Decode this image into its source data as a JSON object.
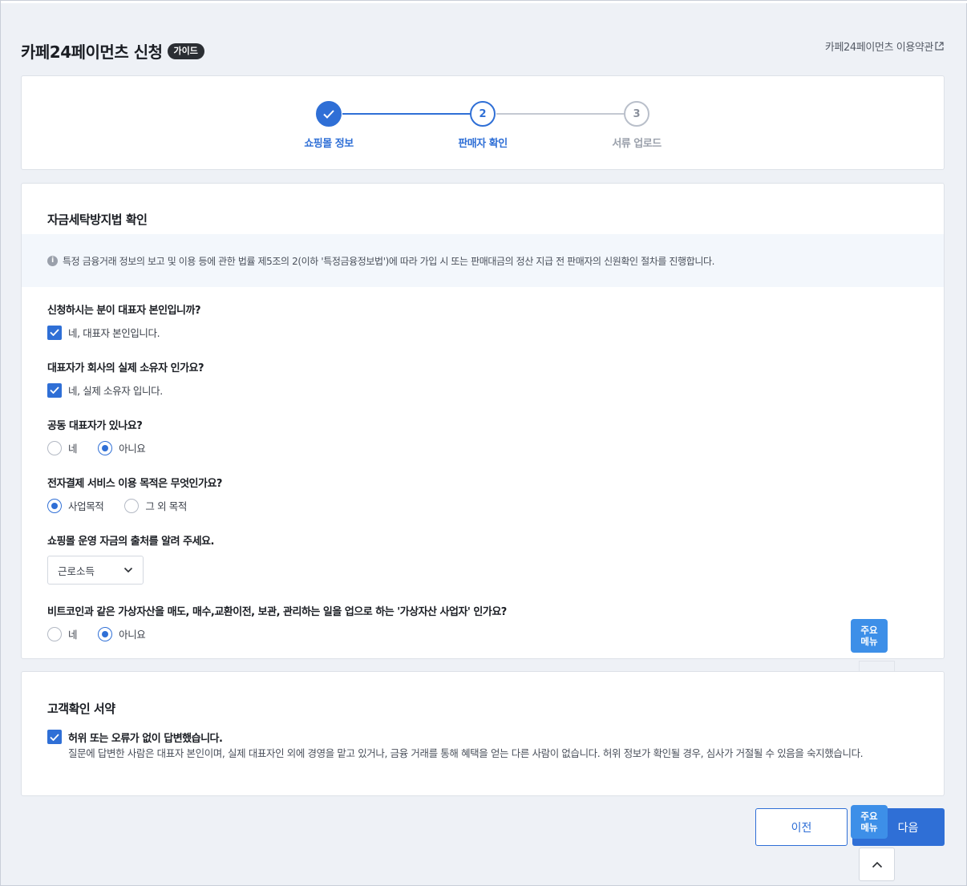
{
  "header": {
    "title": "카페24페이먼츠 신청",
    "guide_badge": "가이드",
    "terms_link": "카페24페이먼츠 이용약관"
  },
  "steps": [
    {
      "label": "쇼핑몰 정보",
      "number": "",
      "state": "done"
    },
    {
      "label": "판매자 확인",
      "number": "2",
      "state": "active"
    },
    {
      "label": "서류 업로드",
      "number": "3",
      "state": "todo"
    }
  ],
  "aml": {
    "title": "자금세탁방지법 확인",
    "notice": "특정 금융거래 정보의 보고 및 이용 등에 관한 법률 제5조의 2(이하 '특정금융정보법')에 따라 가입 시 또는 판매대금의 정산 지급 전 판매자의 신원확인 절차를 진행합니다.",
    "q1": {
      "label": "신청하시는 분이 대표자 본인입니까?",
      "option": "네, 대표자 본인입니다.",
      "checked": true
    },
    "q2": {
      "label": "대표자가 회사의 실제 소유자 인가요?",
      "option": "네, 실제 소유자 입니다.",
      "checked": true
    },
    "q3": {
      "label": "공동 대표자가 있나요?",
      "options": [
        "네",
        "아니요"
      ],
      "selected": "아니요"
    },
    "q4": {
      "label": "전자결제 서비스 이용 목적은 무엇인가요?",
      "options": [
        "사업목적",
        "그 외 목적"
      ],
      "selected": "사업목적"
    },
    "q5": {
      "label": "쇼핑몰 운영 자금의 출처를 알려 주세요.",
      "select_value": "근로소득"
    },
    "q6": {
      "label": "비트코인과 같은 가상자산을 매도, 매수,교환이전, 보관, 관리하는 일을 업으로 하는 '가상자산 사업자' 인가요?",
      "options": [
        "네",
        "아니요"
      ],
      "selected": "아니요"
    }
  },
  "signature": {
    "title": "고객확인 서약",
    "checkbox_label": "허위 또는 오류가 없이 답변했습니다.",
    "checked": true,
    "description": "질문에 답변한 사람은 대표자 본인이며, 실제 대표자인 외에 경영을 맡고 있거나, 금융 거래를 통해 혜택을 얻는 다른 사람이 없습니다. 허위 정보가 확인될 경우, 심사가 거절될 수 있음을 숙지했습니다."
  },
  "buttons": {
    "prev": "이전",
    "next": "다음"
  },
  "quick_menu": {
    "line1": "주요",
    "line2": "메뉴"
  },
  "colors": {
    "accent": "#2f6fd6",
    "quick_menu": "#3d8fe8",
    "background": "#eef1f6"
  }
}
